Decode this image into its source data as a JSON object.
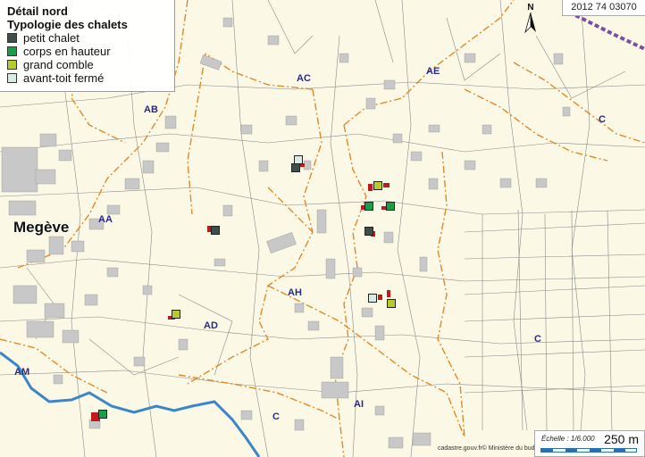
{
  "legend": {
    "title1": "Détail nord",
    "title2": "Typologie des chalets",
    "items": [
      {
        "label": "petit chalet",
        "color": "#3d4f4a"
      },
      {
        "label": "corps en hauteur",
        "color": "#17a04a"
      },
      {
        "label": "grand comble",
        "color": "#b5cc2a"
      },
      {
        "label": "avant-toit fermé",
        "color": "#d6ece4"
      }
    ]
  },
  "reference": "2012 74 03070",
  "north_label": "N",
  "town": "Megève",
  "sections": [
    "AB",
    "AC",
    "AE",
    "C",
    "AA",
    "AH",
    "AD",
    "C",
    "AM",
    "AI",
    "C"
  ],
  "credit": "cadastre.gouv.fr© Ministère du budget",
  "scale": {
    "label": "Échelle : 1/6.000",
    "distance": "250 m"
  },
  "colors": {
    "parcel_line": "#7a7a7a",
    "section_boundary": "#e08a2a",
    "commune_boundary": "#7b4fa0",
    "building": "#c8c8c8",
    "river": "#3a86c8",
    "chalet_highlight": "#c21a1a"
  }
}
